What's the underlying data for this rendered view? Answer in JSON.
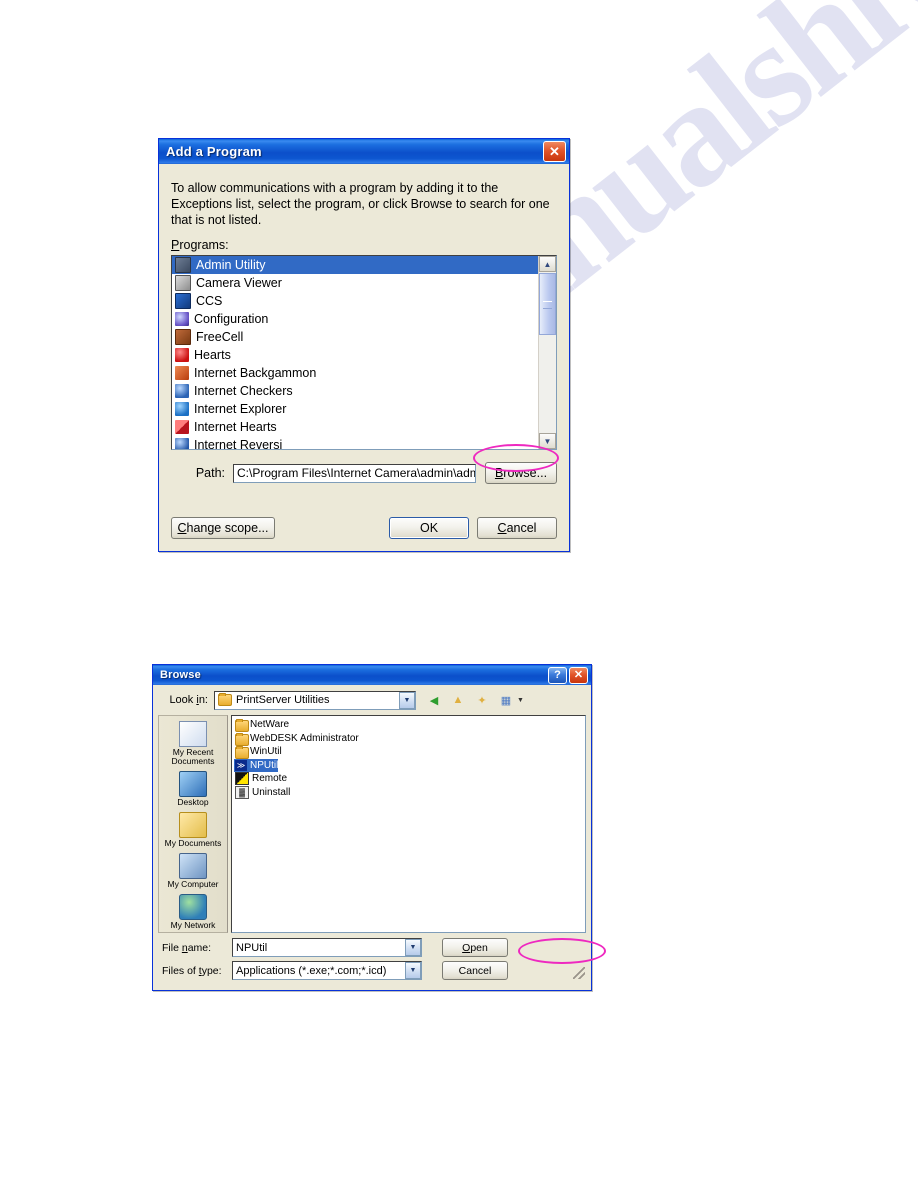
{
  "page": {
    "watermark": "manualshive.com"
  },
  "add_program_dialog": {
    "title": "Add a Program",
    "close_label": "✕",
    "description": "To allow communications with a program by adding it to the Exceptions list, select the program, or click Browse to search for one that is not listed.",
    "programs_label": "Programs:",
    "programs": [
      {
        "label": "Admin Utility",
        "icon": "admin-utility-icon",
        "selected": true
      },
      {
        "label": "Camera Viewer",
        "icon": "camera-viewer-icon",
        "selected": false
      },
      {
        "label": "CCS",
        "icon": "ccs-icon",
        "selected": false
      },
      {
        "label": "Configuration",
        "icon": "configuration-icon",
        "selected": false
      },
      {
        "label": "FreeCell",
        "icon": "freecell-icon",
        "selected": false
      },
      {
        "label": "Hearts",
        "icon": "hearts-icon",
        "selected": false
      },
      {
        "label": "Internet Backgammon",
        "icon": "internet-backgammon-icon",
        "selected": false
      },
      {
        "label": "Internet Checkers",
        "icon": "internet-checkers-icon",
        "selected": false
      },
      {
        "label": "Internet Explorer",
        "icon": "internet-explorer-icon",
        "selected": false
      },
      {
        "label": "Internet Hearts",
        "icon": "internet-hearts-icon",
        "selected": false
      },
      {
        "label": "Internet Reversi",
        "icon": "internet-reversi-icon",
        "selected": false
      }
    ],
    "path_label": "Path:",
    "path_value": "C:\\Program Files\\Internet Camera\\admin\\admi",
    "browse_label": "Browse...",
    "change_scope_label": "Change scope...",
    "ok_label": "OK",
    "cancel_label": "Cancel",
    "highlight_color": "#ee29c0"
  },
  "browse_dialog": {
    "title": "Browse",
    "help_label": "?",
    "close_label": "✕",
    "lookin_label": "Look in:",
    "lookin_value": "PrintServer Utilities",
    "toolbar": [
      {
        "name": "back-icon",
        "glyph": "◀"
      },
      {
        "name": "up-one-level-icon",
        "glyph": "▲"
      },
      {
        "name": "new-folder-icon",
        "glyph": "✦"
      },
      {
        "name": "views-icon",
        "glyph": "▦"
      }
    ],
    "places": [
      {
        "label": "My Recent Documents",
        "icon": "recent-documents-icon"
      },
      {
        "label": "Desktop",
        "icon": "desktop-icon"
      },
      {
        "label": "My Documents",
        "icon": "my-documents-icon"
      },
      {
        "label": "My Computer",
        "icon": "my-computer-icon"
      },
      {
        "label": "My Network",
        "icon": "my-network-places-icon"
      }
    ],
    "files": [
      {
        "label": "NetWare",
        "icon": "folder-icon",
        "selected": false
      },
      {
        "label": "WebDESK Administrator",
        "icon": "folder-icon",
        "selected": false
      },
      {
        "label": "WinUtil",
        "icon": "folder-icon",
        "selected": false
      },
      {
        "label": "NPUtil",
        "icon": "npu-application-icon",
        "selected": true
      },
      {
        "label": "Remote",
        "icon": "remote-application-icon",
        "selected": false
      },
      {
        "label": "Uninstall",
        "icon": "uninstall-application-icon",
        "selected": false
      }
    ],
    "filename_label": "File name:",
    "filename_value": "NPUtil",
    "filetype_label": "Files of type:",
    "filetype_value": "Applications (*.exe;*.com;*.icd)",
    "open_label": "Open",
    "cancel_label": "Cancel",
    "highlight_color": "#ee29c0"
  }
}
